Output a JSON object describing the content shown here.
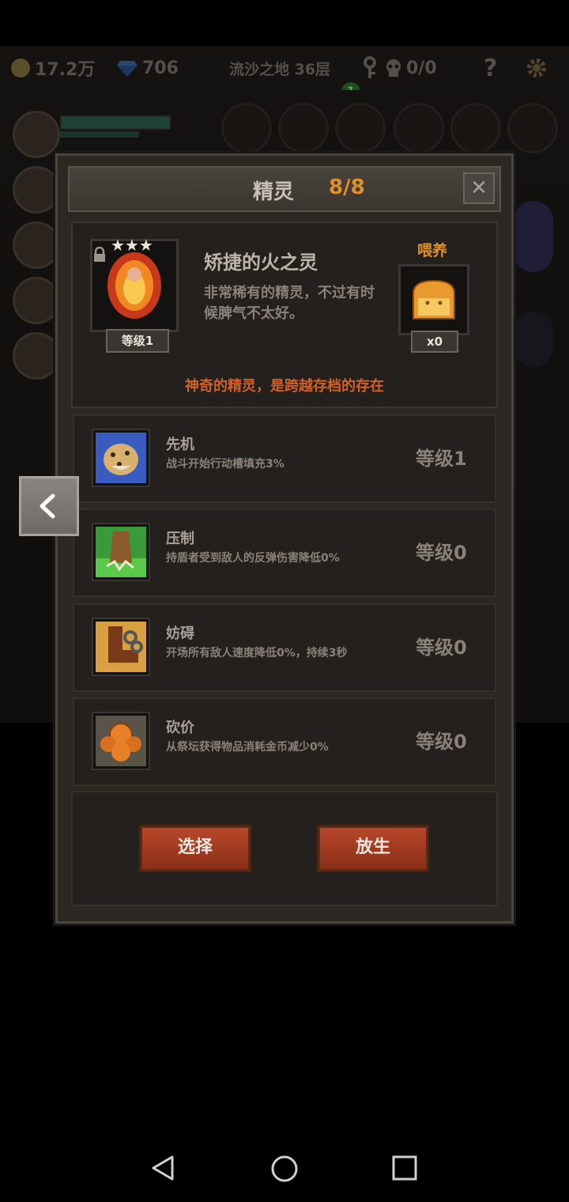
{
  "topbar": {
    "gold": "17.2万",
    "gems": "706",
    "location": "流沙之地 36层",
    "badge_count": "1",
    "skull_count": "0/0",
    "help_label": "?"
  },
  "dialog": {
    "title": "精灵",
    "count": "8/8",
    "close_label": "✕",
    "spirit": {
      "stars": "★★★",
      "level": "等级1",
      "name": "矫捷的火之灵",
      "description": "非常稀有的精灵，不过有时候脾气不太好。",
      "feed_label": "喂养",
      "feed_count": "x0"
    },
    "tagline": "神奇的精灵，是跨越存档的存在",
    "skills": [
      {
        "name": "先机",
        "description": "战斗开始行动槽填充3%",
        "level": "等级1"
      },
      {
        "name": "压制",
        "description": "持盾者受到敌人的反弹伤害降低0%",
        "level": "等级0"
      },
      {
        "name": "妨碍",
        "description": "开场所有敌人速度降低0%，持续3秒",
        "level": "等级0"
      },
      {
        "name": "砍价",
        "description": "从祭坛获得物品消耗金币减少0%",
        "level": "等级0"
      }
    ],
    "select_label": "选择",
    "release_label": "放生"
  },
  "colors": {
    "accent_orange": "#e0902a",
    "tagline_red": "#d0602a",
    "button_red": "#b8482a"
  }
}
